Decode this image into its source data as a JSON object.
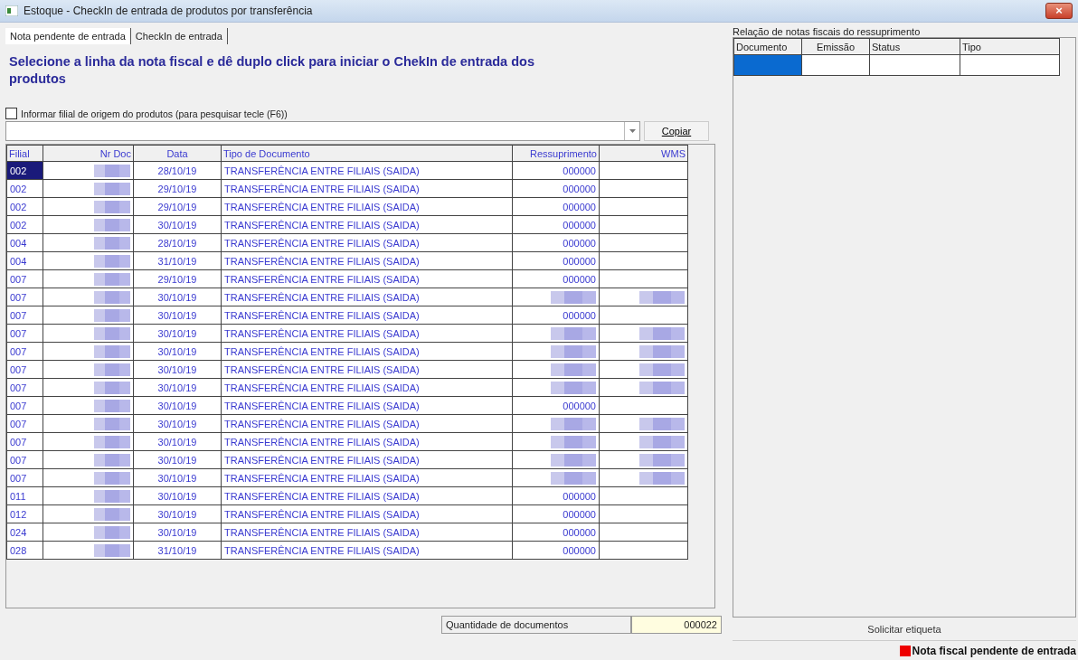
{
  "window": {
    "title": "Estoque - CheckIn de entrada de produtos por transferência",
    "close": "×"
  },
  "tabs": [
    {
      "label": "Nota pendente de entrada",
      "selected": true
    },
    {
      "label": "CheckIn de entrada",
      "selected": false
    }
  ],
  "instruction": "Selecione a linha da nota fiscal  e dê duplo click para iniciar o ChekIn de entrada dos produtos",
  "filter": {
    "label": "Informar filial de origem do produtos (para pesquisar tecle (F6))",
    "checked": false
  },
  "copy_button": "Copiar",
  "table": {
    "columns": [
      "Filial",
      "Nr Doc",
      "Data",
      "Tipo de Documento",
      "Ressuprimento",
      "WMS"
    ],
    "rows": [
      {
        "filial": "002",
        "nr_doc_hidden": true,
        "data": "28/10/19",
        "tipo": "TRANSFERÊNCIA ENTRE FILIAIS (SAIDA)",
        "ressuprimento": "000000",
        "ressuprimento_hidden": false,
        "wms_hidden": false,
        "selected": true
      },
      {
        "filial": "002",
        "nr_doc_hidden": true,
        "data": "29/10/19",
        "tipo": "TRANSFERÊNCIA ENTRE FILIAIS (SAIDA)",
        "ressuprimento": "000000",
        "ressuprimento_hidden": false,
        "wms_hidden": false,
        "selected": false
      },
      {
        "filial": "002",
        "nr_doc_hidden": true,
        "data": "29/10/19",
        "tipo": "TRANSFERÊNCIA ENTRE FILIAIS (SAIDA)",
        "ressuprimento": "000000",
        "ressuprimento_hidden": false,
        "wms_hidden": false,
        "selected": false
      },
      {
        "filial": "002",
        "nr_doc_hidden": true,
        "data": "30/10/19",
        "tipo": "TRANSFERÊNCIA ENTRE FILIAIS (SAIDA)",
        "ressuprimento": "000000",
        "ressuprimento_hidden": false,
        "wms_hidden": false,
        "selected": false
      },
      {
        "filial": "004",
        "nr_doc_hidden": true,
        "data": "28/10/19",
        "tipo": "TRANSFERÊNCIA ENTRE FILIAIS (SAIDA)",
        "ressuprimento": "000000",
        "ressuprimento_hidden": false,
        "wms_hidden": false,
        "selected": false
      },
      {
        "filial": "004",
        "nr_doc_hidden": true,
        "data": "31/10/19",
        "tipo": "TRANSFERÊNCIA ENTRE FILIAIS (SAIDA)",
        "ressuprimento": "000000",
        "ressuprimento_hidden": false,
        "wms_hidden": false,
        "selected": false
      },
      {
        "filial": "007",
        "nr_doc_hidden": true,
        "data": "29/10/19",
        "tipo": "TRANSFERÊNCIA ENTRE FILIAIS (SAIDA)",
        "ressuprimento": "000000",
        "ressuprimento_hidden": false,
        "wms_hidden": false,
        "selected": false
      },
      {
        "filial": "007",
        "nr_doc_hidden": true,
        "data": "30/10/19",
        "tipo": "TRANSFERÊNCIA ENTRE FILIAIS (SAIDA)",
        "ressuprimento_hidden": true,
        "wms_hidden": true,
        "selected": false
      },
      {
        "filial": "007",
        "nr_doc_hidden": true,
        "data": "30/10/19",
        "tipo": "TRANSFERÊNCIA ENTRE FILIAIS (SAIDA)",
        "ressuprimento": "000000",
        "ressuprimento_hidden": false,
        "wms_hidden": false,
        "selected": false
      },
      {
        "filial": "007",
        "nr_doc_hidden": true,
        "data": "30/10/19",
        "tipo": "TRANSFERÊNCIA ENTRE FILIAIS (SAIDA)",
        "ressuprimento_hidden": true,
        "wms_hidden": true,
        "selected": false
      },
      {
        "filial": "007",
        "nr_doc_hidden": true,
        "data": "30/10/19",
        "tipo": "TRANSFERÊNCIA ENTRE FILIAIS (SAIDA)",
        "ressuprimento_hidden": true,
        "wms_hidden": true,
        "selected": false
      },
      {
        "filial": "007",
        "nr_doc_hidden": true,
        "data": "30/10/19",
        "tipo": "TRANSFERÊNCIA ENTRE FILIAIS (SAIDA)",
        "ressuprimento_hidden": true,
        "wms_hidden": true,
        "selected": false
      },
      {
        "filial": "007",
        "nr_doc_hidden": true,
        "data": "30/10/19",
        "tipo": "TRANSFERÊNCIA ENTRE FILIAIS (SAIDA)",
        "ressuprimento_hidden": true,
        "wms_hidden": true,
        "selected": false
      },
      {
        "filial": "007",
        "nr_doc_hidden": true,
        "data": "30/10/19",
        "tipo": "TRANSFERÊNCIA ENTRE FILIAIS (SAIDA)",
        "ressuprimento": "000000",
        "ressuprimento_hidden": false,
        "wms_hidden": false,
        "selected": false
      },
      {
        "filial": "007",
        "nr_doc_hidden": true,
        "data": "30/10/19",
        "tipo": "TRANSFERÊNCIA ENTRE FILIAIS (SAIDA)",
        "ressuprimento_hidden": true,
        "wms_hidden": true,
        "selected": false
      },
      {
        "filial": "007",
        "nr_doc_hidden": true,
        "data": "30/10/19",
        "tipo": "TRANSFERÊNCIA ENTRE FILIAIS (SAIDA)",
        "ressuprimento_hidden": true,
        "wms_hidden": true,
        "selected": false
      },
      {
        "filial": "007",
        "nr_doc_hidden": true,
        "data": "30/10/19",
        "tipo": "TRANSFERÊNCIA ENTRE FILIAIS (SAIDA)",
        "ressuprimento_hidden": true,
        "wms_hidden": true,
        "selected": false
      },
      {
        "filial": "007",
        "nr_doc_hidden": true,
        "data": "30/10/19",
        "tipo": "TRANSFERÊNCIA ENTRE FILIAIS (SAIDA)",
        "ressuprimento_hidden": true,
        "wms_hidden": true,
        "selected": false
      },
      {
        "filial": "011",
        "nr_doc_hidden": true,
        "data": "30/10/19",
        "tipo": "TRANSFERÊNCIA ENTRE FILIAIS (SAIDA)",
        "ressuprimento": "000000",
        "ressuprimento_hidden": false,
        "wms_hidden": false,
        "selected": false
      },
      {
        "filial": "012",
        "nr_doc_hidden": true,
        "data": "30/10/19",
        "tipo": "TRANSFERÊNCIA ENTRE FILIAIS (SAIDA)",
        "ressuprimento": "000000",
        "ressuprimento_hidden": false,
        "wms_hidden": false,
        "selected": false
      },
      {
        "filial": "024",
        "nr_doc_hidden": true,
        "data": "30/10/19",
        "tipo": "TRANSFERÊNCIA ENTRE FILIAIS (SAIDA)",
        "ressuprimento": "000000",
        "ressuprimento_hidden": false,
        "wms_hidden": false,
        "selected": false
      },
      {
        "filial": "028",
        "nr_doc_hidden": true,
        "data": "31/10/19",
        "tipo": "TRANSFERÊNCIA ENTRE FILIAIS (SAIDA)",
        "ressuprimento": "000000",
        "ressuprimento_hidden": false,
        "wms_hidden": false,
        "selected": false
      }
    ]
  },
  "count": {
    "label": "Quantidade de documentos",
    "value": "000022"
  },
  "side": {
    "title": "Relação de notas fiscais do ressuprimento",
    "columns": [
      "Documento",
      "Emissão",
      "Status",
      "Tipo"
    ],
    "rows": [
      {
        "selected": true
      }
    ]
  },
  "label_button": "Solicitar etiqueta",
  "legend": {
    "label": "Nota fiscal pendente de entrada",
    "color": "#ee0000"
  }
}
